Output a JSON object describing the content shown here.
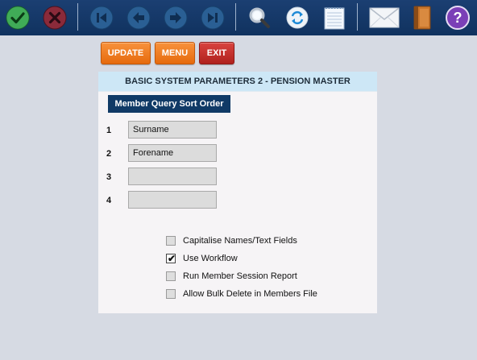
{
  "toolbar": {
    "icons": [
      "confirm-icon",
      "cancel-icon",
      "first-record-icon",
      "previous-record-icon",
      "next-record-icon",
      "last-record-icon",
      "search-icon",
      "refresh-icon",
      "notepad-icon",
      "mail-icon",
      "book-icon",
      "help-icon"
    ],
    "help_glyph": "?",
    "colors": {
      "bar": "#10325f",
      "confirm": "#1f9e3a",
      "cancel": "#c0302b",
      "help": "#7b3fb7"
    }
  },
  "actions": {
    "update_label": "UPDATE",
    "menu_label": "MENU",
    "exit_label": "EXIT",
    "colors": {
      "orange": "#f27d22",
      "red": "#c12a26"
    }
  },
  "panel": {
    "title": "BASIC SYSTEM PARAMETERS 2 - PENSION MASTER",
    "section_header": "Member Query Sort Order",
    "sort_fields": [
      {
        "number": "1",
        "value": "Surname"
      },
      {
        "number": "2",
        "value": "Forename"
      },
      {
        "number": "3",
        "value": ""
      },
      {
        "number": "4",
        "value": ""
      }
    ],
    "options": [
      {
        "label": "Capitalise Names/Text Fields",
        "checked": false
      },
      {
        "label": "Use Workflow",
        "checked": true
      },
      {
        "label": "Run Member Session Report",
        "checked": false
      },
      {
        "label": "Allow Bulk Delete in Members File",
        "checked": false
      }
    ],
    "check_mark": "✔"
  }
}
